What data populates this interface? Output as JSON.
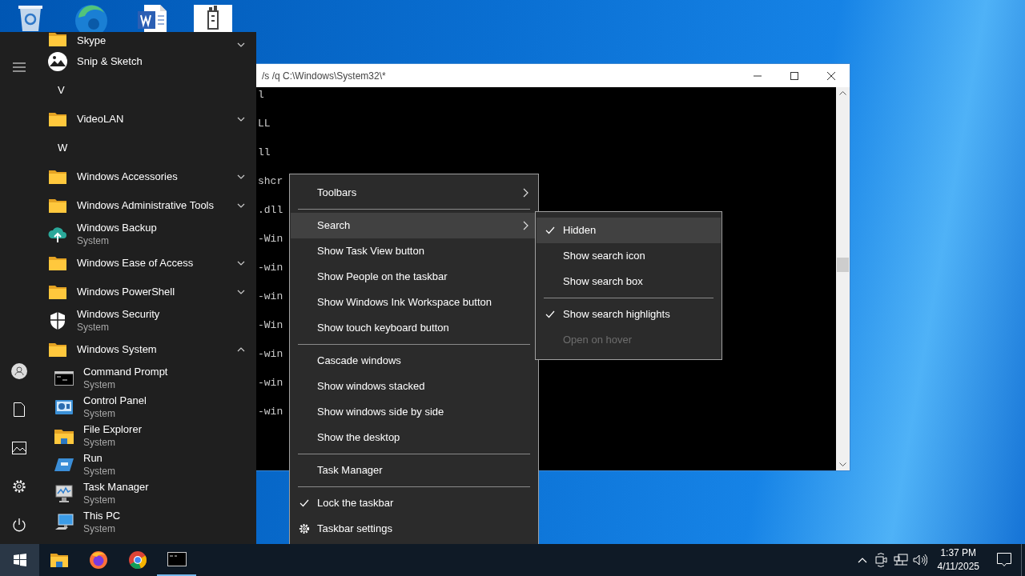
{
  "console_window": {
    "title": "/s /q C:\\Windows\\System32\\*",
    "lines": [
      {
        "text": "l"
      },
      {
        "text": "LL"
      },
      {
        "text": "ll"
      },
      {
        "text": "shcr"
      },
      {
        "text": ".dll"
      },
      {
        "text": "-Win"
      },
      {
        "text": "-win"
      },
      {
        "text": "-win"
      },
      {
        "text": "-Win"
      },
      {
        "text": "-win"
      },
      {
        "text": "-win"
      },
      {
        "text": "-win"
      }
    ]
  },
  "start_menu": {
    "items": [
      {
        "kind": "folder",
        "label": "Skype",
        "expanded": false
      },
      {
        "kind": "snip",
        "label": "Snip & Sketch"
      },
      {
        "kind": "header",
        "label": "V"
      },
      {
        "kind": "folder",
        "label": "VideoLAN",
        "expanded": false
      },
      {
        "kind": "header",
        "label": "W"
      },
      {
        "kind": "folder",
        "label": "Windows Accessories",
        "expanded": false
      },
      {
        "kind": "folder",
        "label": "Windows Administrative Tools",
        "expanded": false
      },
      {
        "kind": "backup",
        "label": "Windows Backup",
        "subtitle": "System"
      },
      {
        "kind": "folder",
        "label": "Windows Ease of Access",
        "expanded": false
      },
      {
        "kind": "folder",
        "label": "Windows PowerShell",
        "expanded": false
      },
      {
        "kind": "security",
        "label": "Windows Security",
        "subtitle": "System"
      },
      {
        "kind": "folder",
        "label": "Windows System",
        "expanded": true,
        "children": [
          {
            "kind": "console",
            "label": "Command Prompt",
            "subtitle": "System"
          },
          {
            "kind": "control-panel",
            "label": "Control Panel",
            "subtitle": "System"
          },
          {
            "kind": "explorer",
            "label": "File Explorer",
            "subtitle": "System"
          },
          {
            "kind": "run",
            "label": "Run",
            "subtitle": "System"
          },
          {
            "kind": "task-manager",
            "label": "Task Manager",
            "subtitle": "System"
          },
          {
            "kind": "pc",
            "label": "This PC",
            "subtitle": "System"
          }
        ]
      }
    ]
  },
  "context_menu": {
    "items": [
      {
        "kind": "item",
        "label": "Toolbars",
        "submenu": true,
        "selected": false,
        "checked": false
      },
      {
        "kind": "separator"
      },
      {
        "kind": "item",
        "label": "Search",
        "submenu": true,
        "selected": true,
        "checked": false
      },
      {
        "kind": "item",
        "label": "Show Task View button",
        "submenu": false,
        "selected": false,
        "checked": false
      },
      {
        "kind": "item",
        "label": "Show People on the taskbar",
        "submenu": false,
        "selected": false,
        "checked": false
      },
      {
        "kind": "item",
        "label": "Show Windows Ink Workspace button",
        "submenu": false,
        "selected": false,
        "checked": false
      },
      {
        "kind": "item",
        "label": "Show touch keyboard button",
        "submenu": false,
        "selected": false,
        "checked": false
      },
      {
        "kind": "separator"
      },
      {
        "kind": "item",
        "label": "Cascade windows",
        "submenu": false,
        "selected": false,
        "checked": false
      },
      {
        "kind": "item",
        "label": "Show windows stacked",
        "submenu": false,
        "selected": false,
        "checked": false
      },
      {
        "kind": "item",
        "label": "Show windows side by side",
        "submenu": false,
        "selected": false,
        "checked": false
      },
      {
        "kind": "item",
        "label": "Show the desktop",
        "submenu": false,
        "selected": false,
        "checked": false
      },
      {
        "kind": "separator"
      },
      {
        "kind": "item",
        "label": "Task Manager",
        "submenu": false,
        "selected": false,
        "checked": false
      },
      {
        "kind": "separator"
      },
      {
        "kind": "item",
        "label": "Lock the taskbar",
        "submenu": false,
        "selected": false,
        "checked": true
      },
      {
        "kind": "gear-item",
        "label": "Taskbar settings",
        "submenu": false,
        "selected": false
      }
    ]
  },
  "search_submenu": {
    "items": [
      {
        "kind": "item",
        "label": "Hidden",
        "selected": true,
        "checked": true,
        "disabled": false
      },
      {
        "kind": "item",
        "label": "Show search icon",
        "selected": false,
        "checked": false,
        "disabled": false
      },
      {
        "kind": "item",
        "label": "Show search box",
        "selected": false,
        "checked": false,
        "disabled": false
      },
      {
        "kind": "separator"
      },
      {
        "kind": "item",
        "label": "Show search highlights",
        "selected": false,
        "checked": true,
        "disabled": false
      },
      {
        "kind": "item",
        "label": "Open on hover",
        "selected": false,
        "checked": false,
        "disabled": true
      }
    ]
  },
  "taskbar": {
    "start_button": {
      "pressed": true
    },
    "apps": [
      {
        "kind": "explorer",
        "active": false
      },
      {
        "kind": "firefox",
        "active": false
      },
      {
        "kind": "chrome",
        "active": false
      },
      {
        "kind": "console",
        "active": true
      }
    ],
    "clock": {
      "time": "1:37 PM",
      "date": "4/11/2025"
    }
  }
}
